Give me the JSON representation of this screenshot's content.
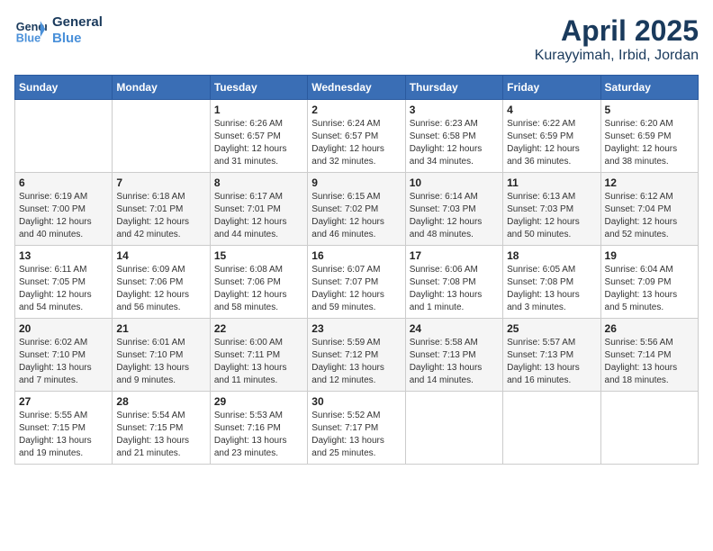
{
  "logo": {
    "line1": "General",
    "line2": "Blue"
  },
  "title": "April 2025",
  "location": "Kurayyimah, Irbid, Jordan",
  "weekdays": [
    "Sunday",
    "Monday",
    "Tuesday",
    "Wednesday",
    "Thursday",
    "Friday",
    "Saturday"
  ],
  "weeks": [
    [
      {
        "day": "",
        "detail": ""
      },
      {
        "day": "",
        "detail": ""
      },
      {
        "day": "1",
        "detail": "Sunrise: 6:26 AM\nSunset: 6:57 PM\nDaylight: 12 hours\nand 31 minutes."
      },
      {
        "day": "2",
        "detail": "Sunrise: 6:24 AM\nSunset: 6:57 PM\nDaylight: 12 hours\nand 32 minutes."
      },
      {
        "day": "3",
        "detail": "Sunrise: 6:23 AM\nSunset: 6:58 PM\nDaylight: 12 hours\nand 34 minutes."
      },
      {
        "day": "4",
        "detail": "Sunrise: 6:22 AM\nSunset: 6:59 PM\nDaylight: 12 hours\nand 36 minutes."
      },
      {
        "day": "5",
        "detail": "Sunrise: 6:20 AM\nSunset: 6:59 PM\nDaylight: 12 hours\nand 38 minutes."
      }
    ],
    [
      {
        "day": "6",
        "detail": "Sunrise: 6:19 AM\nSunset: 7:00 PM\nDaylight: 12 hours\nand 40 minutes."
      },
      {
        "day": "7",
        "detail": "Sunrise: 6:18 AM\nSunset: 7:01 PM\nDaylight: 12 hours\nand 42 minutes."
      },
      {
        "day": "8",
        "detail": "Sunrise: 6:17 AM\nSunset: 7:01 PM\nDaylight: 12 hours\nand 44 minutes."
      },
      {
        "day": "9",
        "detail": "Sunrise: 6:15 AM\nSunset: 7:02 PM\nDaylight: 12 hours\nand 46 minutes."
      },
      {
        "day": "10",
        "detail": "Sunrise: 6:14 AM\nSunset: 7:03 PM\nDaylight: 12 hours\nand 48 minutes."
      },
      {
        "day": "11",
        "detail": "Sunrise: 6:13 AM\nSunset: 7:03 PM\nDaylight: 12 hours\nand 50 minutes."
      },
      {
        "day": "12",
        "detail": "Sunrise: 6:12 AM\nSunset: 7:04 PM\nDaylight: 12 hours\nand 52 minutes."
      }
    ],
    [
      {
        "day": "13",
        "detail": "Sunrise: 6:11 AM\nSunset: 7:05 PM\nDaylight: 12 hours\nand 54 minutes."
      },
      {
        "day": "14",
        "detail": "Sunrise: 6:09 AM\nSunset: 7:06 PM\nDaylight: 12 hours\nand 56 minutes."
      },
      {
        "day": "15",
        "detail": "Sunrise: 6:08 AM\nSunset: 7:06 PM\nDaylight: 12 hours\nand 58 minutes."
      },
      {
        "day": "16",
        "detail": "Sunrise: 6:07 AM\nSunset: 7:07 PM\nDaylight: 12 hours\nand 59 minutes."
      },
      {
        "day": "17",
        "detail": "Sunrise: 6:06 AM\nSunset: 7:08 PM\nDaylight: 13 hours\nand 1 minute."
      },
      {
        "day": "18",
        "detail": "Sunrise: 6:05 AM\nSunset: 7:08 PM\nDaylight: 13 hours\nand 3 minutes."
      },
      {
        "day": "19",
        "detail": "Sunrise: 6:04 AM\nSunset: 7:09 PM\nDaylight: 13 hours\nand 5 minutes."
      }
    ],
    [
      {
        "day": "20",
        "detail": "Sunrise: 6:02 AM\nSunset: 7:10 PM\nDaylight: 13 hours\nand 7 minutes."
      },
      {
        "day": "21",
        "detail": "Sunrise: 6:01 AM\nSunset: 7:10 PM\nDaylight: 13 hours\nand 9 minutes."
      },
      {
        "day": "22",
        "detail": "Sunrise: 6:00 AM\nSunset: 7:11 PM\nDaylight: 13 hours\nand 11 minutes."
      },
      {
        "day": "23",
        "detail": "Sunrise: 5:59 AM\nSunset: 7:12 PM\nDaylight: 13 hours\nand 12 minutes."
      },
      {
        "day": "24",
        "detail": "Sunrise: 5:58 AM\nSunset: 7:13 PM\nDaylight: 13 hours\nand 14 minutes."
      },
      {
        "day": "25",
        "detail": "Sunrise: 5:57 AM\nSunset: 7:13 PM\nDaylight: 13 hours\nand 16 minutes."
      },
      {
        "day": "26",
        "detail": "Sunrise: 5:56 AM\nSunset: 7:14 PM\nDaylight: 13 hours\nand 18 minutes."
      }
    ],
    [
      {
        "day": "27",
        "detail": "Sunrise: 5:55 AM\nSunset: 7:15 PM\nDaylight: 13 hours\nand 19 minutes."
      },
      {
        "day": "28",
        "detail": "Sunrise: 5:54 AM\nSunset: 7:15 PM\nDaylight: 13 hours\nand 21 minutes."
      },
      {
        "day": "29",
        "detail": "Sunrise: 5:53 AM\nSunset: 7:16 PM\nDaylight: 13 hours\nand 23 minutes."
      },
      {
        "day": "30",
        "detail": "Sunrise: 5:52 AM\nSunset: 7:17 PM\nDaylight: 13 hours\nand 25 minutes."
      },
      {
        "day": "",
        "detail": ""
      },
      {
        "day": "",
        "detail": ""
      },
      {
        "day": "",
        "detail": ""
      }
    ]
  ]
}
